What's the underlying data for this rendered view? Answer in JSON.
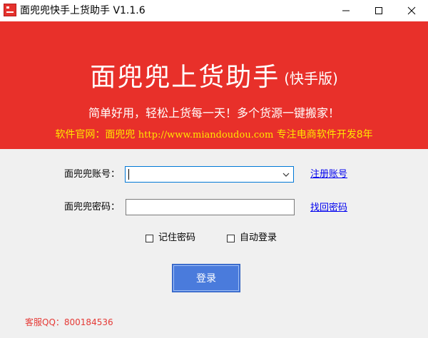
{
  "window": {
    "title": "面兜兜快手上货助手 V1.1.6",
    "icon": "app-logo-icon",
    "controls": [
      "minimize-icon",
      "maximize-icon",
      "close-icon"
    ]
  },
  "banner": {
    "title": "面兜兜上货助手",
    "title_sub": "(快手版)",
    "slogan": "简单好用，轻松上货每一天！多个货源一键搬家！",
    "website_prefix": "软件官网：面兜兜",
    "website_url": "http://www.miandoudou.com",
    "website_suffix": "专注电商软件开发8年",
    "bg_color": "#e8302a",
    "website_color": "#ffe600"
  },
  "form": {
    "account_label": "面兜兜账号：",
    "account_value": "",
    "register_link": "注册账号",
    "password_label": "面兜兜密码：",
    "password_value": "",
    "find_password_link": "找回密码",
    "remember_label": "记住密码",
    "remember_checked": false,
    "autologin_label": "自动登录",
    "autologin_checked": false,
    "login_label": "登录",
    "login_color": "#4a7bdc"
  },
  "footer": {
    "service": "客服QQ：800184536",
    "service_color": "#e53935"
  }
}
